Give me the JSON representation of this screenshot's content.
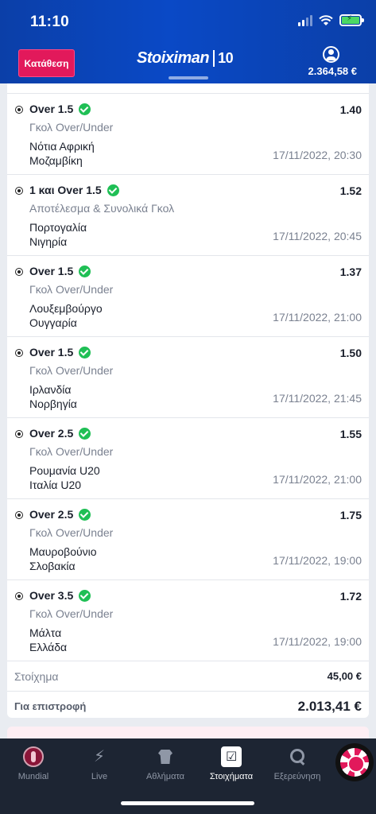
{
  "status_bar": {
    "time": "11:10"
  },
  "header": {
    "deposit_label": "Κατάθεση",
    "logo_text": "Stoiximan",
    "logo_mark": "10",
    "balance": "2.364,58 €"
  },
  "bets": [
    {
      "selection": "Over 1.5",
      "odds": "1.40",
      "market": "Γκολ Over/Under",
      "team1": "Νότια Αφρική",
      "team2": "Μοζαμβίκη",
      "datetime": "17/11/2022, 20:30"
    },
    {
      "selection": "1 και Over 1.5",
      "odds": "1.52",
      "market": "Αποτέλεσμα & Συνολικά Γκολ",
      "team1": "Πορτογαλία",
      "team2": "Νιγηρία",
      "datetime": "17/11/2022, 20:45"
    },
    {
      "selection": "Over 1.5",
      "odds": "1.37",
      "market": "Γκολ Over/Under",
      "team1": "Λουξεμβούργο",
      "team2": "Ουγγαρία",
      "datetime": "17/11/2022, 21:00"
    },
    {
      "selection": "Over 1.5",
      "odds": "1.50",
      "market": "Γκολ Over/Under",
      "team1": "Ιρλανδία",
      "team2": "Νορβηγία",
      "datetime": "17/11/2022, 21:45"
    },
    {
      "selection": "Over 2.5",
      "odds": "1.55",
      "market": "Γκολ Over/Under",
      "team1": "Ρουμανία U20",
      "team2": "Ιταλία U20",
      "datetime": "17/11/2022, 21:00"
    },
    {
      "selection": "Over 2.5",
      "odds": "1.75",
      "market": "Γκολ Over/Under",
      "team1": "Μαυροβούνιο",
      "team2": "Σλοβακία",
      "datetime": "17/11/2022, 19:00"
    },
    {
      "selection": "Over 3.5",
      "odds": "1.72",
      "market": "Γκολ Over/Under",
      "team1": "Μάλτα",
      "team2": "Ελλάδα",
      "datetime": "17/11/2022, 19:00"
    }
  ],
  "summary": {
    "stake_label": "Στοίχημα",
    "stake_value": "45,00 €",
    "return_label": "Για επιστροφή",
    "return_value": "2.013,41 €"
  },
  "tabbar": {
    "tabs": [
      {
        "label": "Mundial",
        "icon": "mundial-icon"
      },
      {
        "label": "Live",
        "icon": "live-icon"
      },
      {
        "label": "Αθλήματα",
        "icon": "sports-jersey-icon"
      },
      {
        "label": "Στοιχήματα",
        "icon": "bets-checklist-icon"
      },
      {
        "label": "Εξερεύνηση",
        "icon": "search-icon"
      }
    ]
  },
  "colors": {
    "header": "#0a49c6",
    "deposit": "#e2195b",
    "check": "#1fbf55",
    "tabbar": "#1d2533"
  }
}
